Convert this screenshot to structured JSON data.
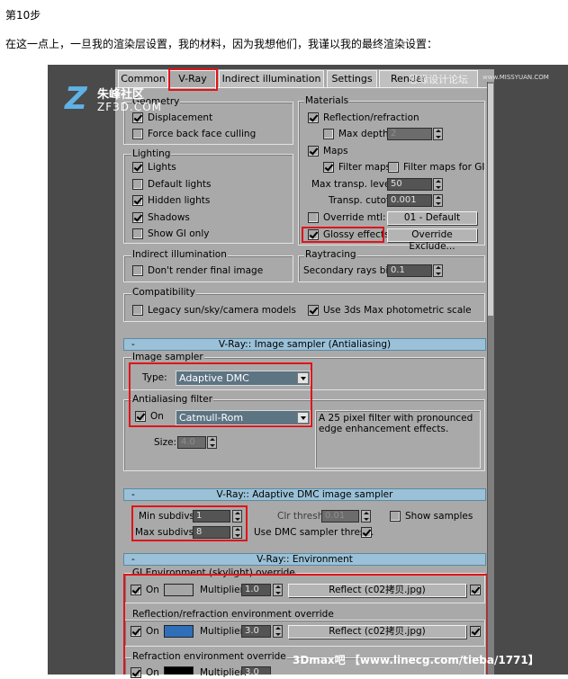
{
  "article": {
    "step": "第10步",
    "intro": "在这一点上，一旦我的渲染层设置，我的材料，因为我想他们，我谨以我的最终渲染设置："
  },
  "tabs": [
    "Common",
    "V-Ray",
    "Indirect illumination",
    "Settings",
    "Render"
  ],
  "watermark": {
    "site_cn": "朱峰社区",
    "site_en": "ZF3D.COM",
    "forum": "思缘设计论坛",
    "url": "www.MISSYUAN.COM",
    "footer": "3Dmax吧 【www.linecg.com/tieba/1771】"
  },
  "global": {
    "geometry": {
      "label": "Geometry",
      "items": [
        {
          "label": "Displacement",
          "checked": true
        },
        {
          "label": "Force back face culling",
          "checked": false
        }
      ]
    },
    "lighting": {
      "label": "Lighting",
      "items": [
        {
          "label": "Lights",
          "checked": true
        },
        {
          "label": "Default lights",
          "checked": false
        },
        {
          "label": "Hidden lights",
          "checked": true
        },
        {
          "label": "Shadows",
          "checked": true
        },
        {
          "label": "Show GI only",
          "checked": false
        }
      ]
    },
    "indirect": {
      "label": "Indirect illumination",
      "dont_render": "Don't render final image"
    },
    "materials": {
      "label": "Materials",
      "refl_refr": "Reflection/refraction",
      "max_depth": "Max depth",
      "max_depth_val": "2",
      "maps": "Maps",
      "filter_maps": "Filter maps",
      "filter_maps_gi": "Filter maps for GI",
      "max_transp": "Max transp. levels",
      "max_transp_val": "50",
      "transp_cutoff": "Transp. cutoff",
      "transp_cutoff_val": "0.001",
      "override_mtl": "Override mtl:",
      "override_mtl_btn": "01 - Default",
      "glossy": "Glossy effects",
      "override_exclude": "Override Exclude..."
    },
    "raytracing": {
      "label": "Raytracing",
      "secondary_bias": "Secondary rays bias",
      "secondary_bias_val": "0.1"
    },
    "compat": {
      "label": "Compatibility",
      "legacy": "Legacy sun/sky/camera models",
      "photometric": "Use 3ds Max photometric scale"
    }
  },
  "image_sampler": {
    "title": "V-Ray:: Image sampler (Antialiasing)",
    "group": "Image sampler",
    "type_label": "Type:",
    "type_val": "Adaptive DMC",
    "aa_group": "Antialiasing filter",
    "on": "On",
    "filter_val": "Catmull-Rom",
    "size_label": "Size:",
    "size_val": "4.0",
    "desc": "A 25 pixel filter with pronounced edge enhancement effects."
  },
  "dmc": {
    "title": "V-Ray:: Adaptive DMC image sampler",
    "min_label": "Min subdivs:",
    "min_val": "1",
    "max_label": "Max subdivs:",
    "max_val": "8",
    "clr_label": "Clr thresh:",
    "clr_val": "0.01",
    "show_samples": "Show samples",
    "use_dmc": "Use DMC sampler thresh."
  },
  "env": {
    "title": "V-Ray:: Environment",
    "gi_label": "GI Environment (skylight) override",
    "refl_label": "Reflection/refraction environment override",
    "refr_label": "Refraction environment override",
    "on": "On",
    "multiplier": "Multiplier:",
    "gi_mult": "1.0",
    "refl_mult": "3.0",
    "refr_mult": "3.0",
    "map": "Reflect (c02拷贝.jpg)",
    "colors": {
      "gi": "#a6a6a6",
      "refl": "#2f6fb9",
      "refr": "#000000"
    }
  },
  "minus": "-"
}
